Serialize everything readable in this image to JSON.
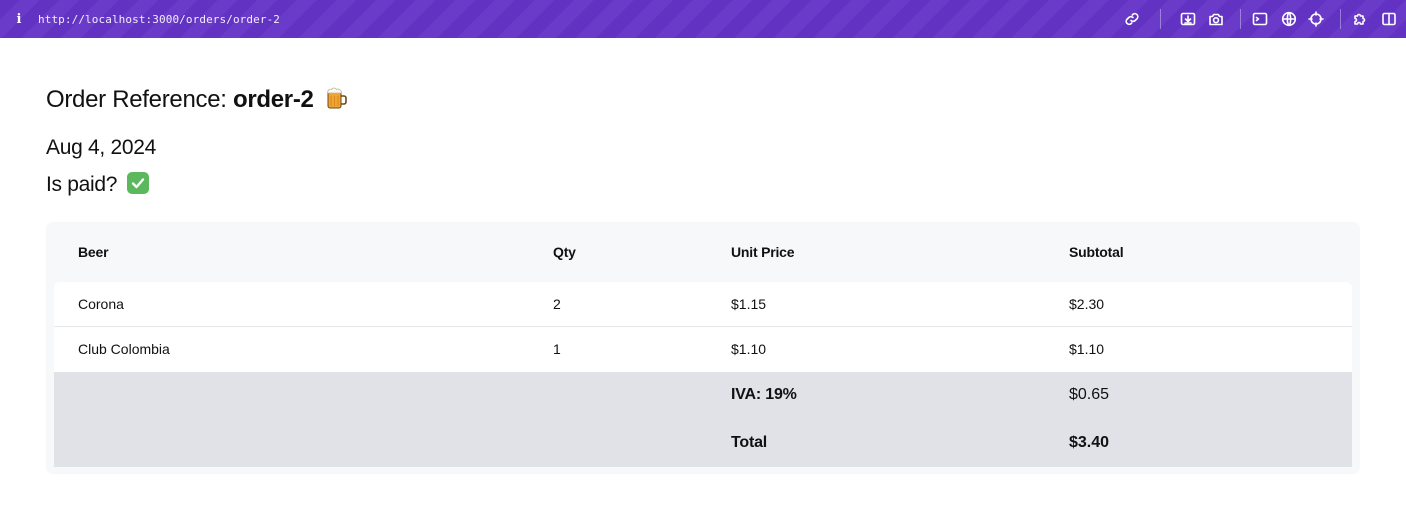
{
  "browser": {
    "info_label": "i",
    "url": "http://localhost:3000/orders/order-2",
    "tools": [
      "link-icon",
      "download-icon",
      "camera-icon",
      "terminal-icon",
      "globe-icon",
      "crosshair-icon",
      "puzzle-icon",
      "sidebar-icon"
    ]
  },
  "order": {
    "title_prefix": "Order Reference: ",
    "reference": "order-2",
    "date": "Aug 4, 2024",
    "paid_label": "Is paid?"
  },
  "table": {
    "headers": [
      "Beer",
      "Qty",
      "Unit Price",
      "Subtotal"
    ],
    "rows": [
      [
        "Corona",
        "2",
        "$1.15",
        "$2.30"
      ],
      [
        "Club Colombia",
        "1",
        "$1.10",
        "$1.10"
      ]
    ],
    "iva_label": "IVA: 19%",
    "iva_value": "$0.65",
    "total_label": "Total",
    "total_value": "$3.40"
  },
  "colors": {
    "topbar": "#6233c2",
    "table_bg": "#f7f8fa",
    "footer_bg": "#e1e2e7",
    "check": "#5cb85c"
  }
}
